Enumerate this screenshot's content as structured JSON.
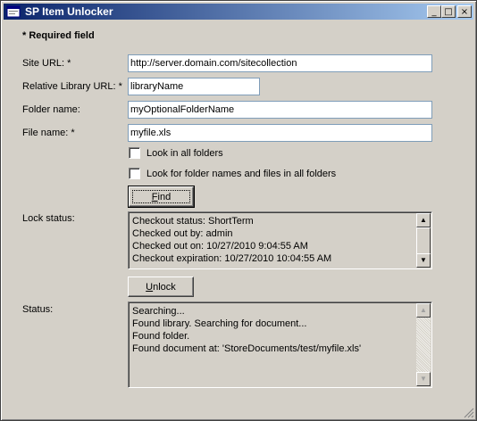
{
  "window": {
    "title": "SP Item Unlocker",
    "controls": {
      "minimize_icon": "minimize-icon",
      "maximize_icon": "maximize-icon",
      "close_icon": "close-icon"
    }
  },
  "form": {
    "required_note": "* Required field",
    "site_url": {
      "label": "Site URL: *",
      "value": "http://server.domain.com/sitecollection"
    },
    "relative_library_url": {
      "label": "Relative Library URL: *",
      "value": "libraryName"
    },
    "folder_name": {
      "label": "Folder name:",
      "value": "myOptionalFolderName"
    },
    "file_name": {
      "label": "File name: *",
      "value": "myfile.xls"
    },
    "look_in_all_folders": {
      "label": "Look in all folders",
      "checked": false
    },
    "look_for_folder_names": {
      "label": "Look for folder names and files in all folders",
      "checked": false
    },
    "find_button": {
      "accel": "F",
      "rest": "ind"
    },
    "lock_status": {
      "label": "Lock status:",
      "lines": [
        "Checkout status: ShortTerm",
        "Checked out by: admin",
        "Checked out on: 10/27/2010 9:04:55 AM",
        "Checkout expiration: 10/27/2010 10:04:55 AM"
      ]
    },
    "unlock_button": {
      "accel": "U",
      "rest": "nlock"
    },
    "status": {
      "label": "Status:",
      "lines": [
        "Searching...",
        "Found library. Searching for document...",
        "Found folder.",
        "Found document at: 'StoreDocuments/test/myfile.xls'"
      ]
    }
  },
  "colors": {
    "titlebar_start": "#0a246a",
    "titlebar_end": "#a6caf0",
    "window_bg": "#d4d0c8"
  }
}
